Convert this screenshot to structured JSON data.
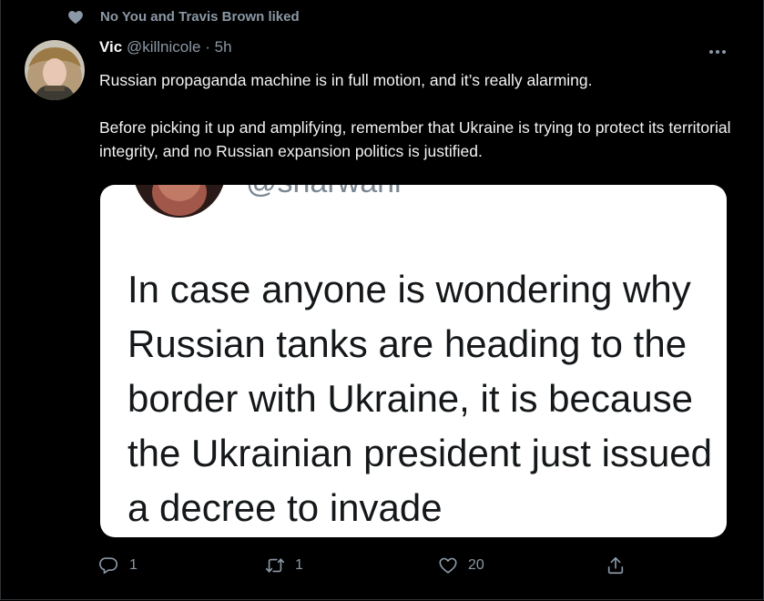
{
  "social_context": {
    "text": "No You and Travis Brown liked",
    "icon": "heart-icon"
  },
  "tweet": {
    "author_name": "Vic",
    "author_handle": "@killnicole",
    "separator": "·",
    "time": "5h",
    "text_paragraphs": [
      "Russian propaganda machine is in full motion, and it’s really alarming.",
      "Before picking it up and amplifying, remember that Ukraine is trying to protect its territorial integrity, and no Russian expansion politics is justified."
    ]
  },
  "media": {
    "quoted_handle": "@sharwani",
    "quoted_text": "In case anyone is wondering why Russian tanks are heading to the border with Ukraine, it is because the Ukrainian president just issued a decree to invade"
  },
  "actions": {
    "reply_count": "1",
    "retweet_count": "1",
    "like_count": "20"
  },
  "colors": {
    "background": "#000000",
    "secondary_text": "#8b98a5",
    "primary_text": "#f7f9f9"
  }
}
